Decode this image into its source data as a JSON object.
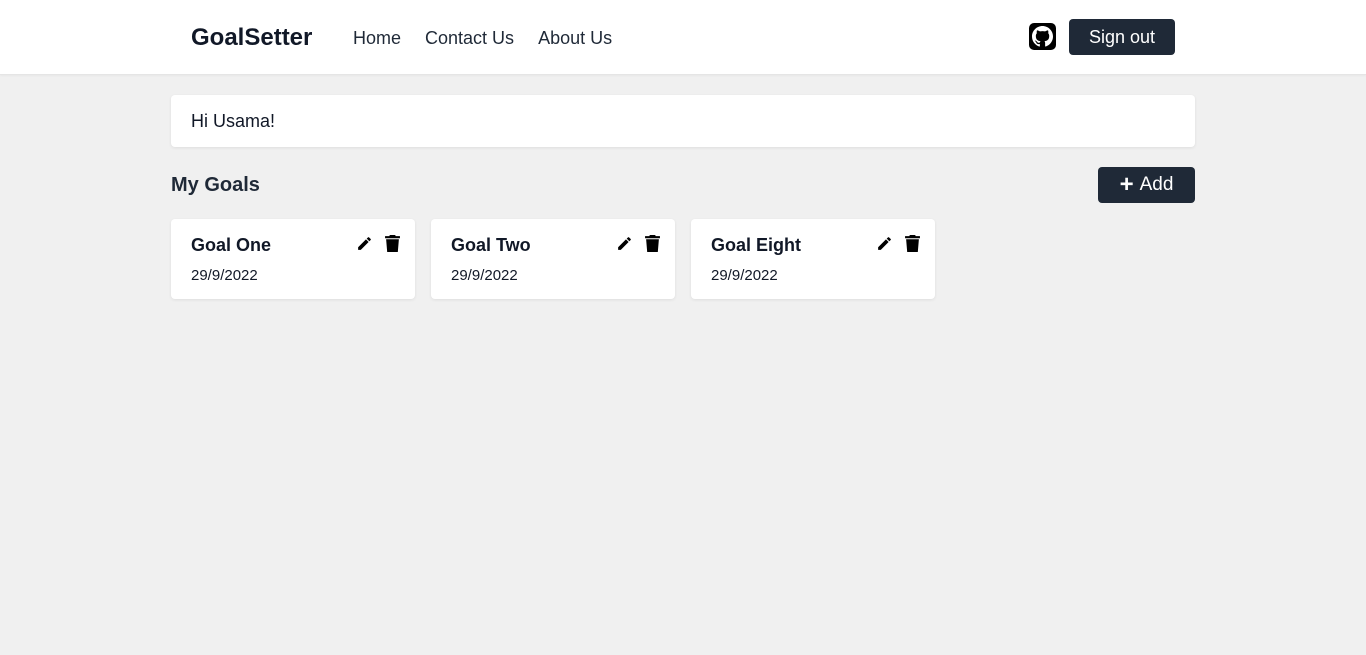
{
  "navbar": {
    "brand": "GoalSetter",
    "links": [
      {
        "label": "Home"
      },
      {
        "label": "Contact Us"
      },
      {
        "label": "About Us"
      }
    ],
    "github_icon": "github-icon",
    "signout_label": "Sign out"
  },
  "greeting": "Hi Usama!",
  "goals_section": {
    "title": "My Goals",
    "add_label": "Add",
    "add_icon": "plus-icon"
  },
  "goals": [
    {
      "title": "Goal One",
      "date": "29/9/2022"
    },
    {
      "title": "Goal Two",
      "date": "29/9/2022"
    },
    {
      "title": "Goal Eight",
      "date": "29/9/2022"
    }
  ],
  "colors": {
    "background": "#f0f0f0",
    "card": "#ffffff",
    "primary_button": "#1f2937",
    "text": "#111827"
  }
}
